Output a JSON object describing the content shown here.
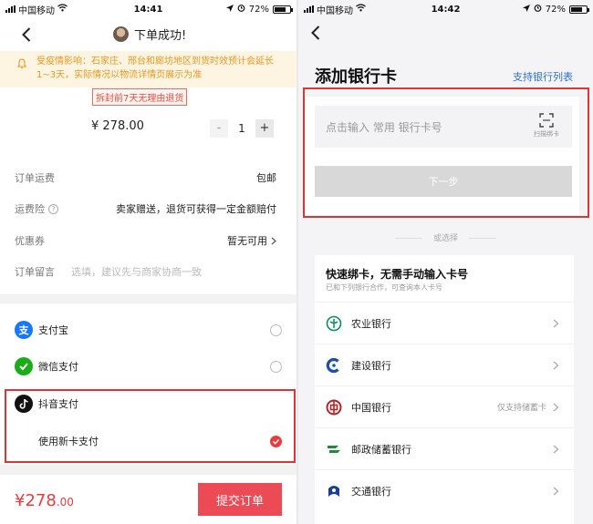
{
  "left": {
    "status": {
      "carrier": "中国移动",
      "time": "14:41",
      "battery": "72%"
    },
    "nav": {
      "title": "下单成功!"
    },
    "notice": "受疫情影响：石家庄、邢台和廊坊地区到货时效预计会延长1~3天，实际情况以物流详情页展示为准",
    "return_tag": "拆封前7天无理由退货",
    "price": "¥ 278.00",
    "stepper": {
      "minus": "-",
      "qty": "1",
      "plus": "+"
    },
    "rows": {
      "shipping": {
        "label": "订单运费",
        "value": "包邮"
      },
      "insurance": {
        "label": "运费险",
        "value": "卖家赠送，退货可获得一定金额赔付"
      },
      "coupon": {
        "label": "优惠券",
        "value": "暂无可用"
      },
      "message": {
        "label": "订单留言",
        "placeholder": "选填，建议先与商家协商一致"
      }
    },
    "payments": {
      "alipay": "支付宝",
      "wechat": "微信支付",
      "douyin": "抖音支付",
      "newcard": "使用新卡支付"
    },
    "total": {
      "main": "¥278",
      "decimal": ".00"
    },
    "submit": "提交订单"
  },
  "right": {
    "status": {
      "carrier": "中国移动",
      "time": "14:42",
      "battery": "72%"
    },
    "title": "添加银行卡",
    "bank_list_link": "支持银行列表",
    "card_input_placeholder": "点击输入 常用 银行卡号",
    "scan_label": "扫描绑卡",
    "next_button": "下一步",
    "or_choose": "或选择",
    "quick": {
      "title": "快速绑卡，无需手动输入卡号",
      "subtitle": "已和下列银行合作，可查询本人卡号"
    },
    "banks": [
      {
        "name": "农业银行",
        "note": "",
        "color": "#0c8c5c"
      },
      {
        "name": "建设银行",
        "note": "",
        "color": "#1f4fa6"
      },
      {
        "name": "中国银行",
        "note": "仅支持储蓄卡",
        "color": "#b0262b"
      },
      {
        "name": "邮政储蓄银行",
        "note": "",
        "color": "#1e8a3a"
      },
      {
        "name": "交通银行",
        "note": "",
        "color": "#1c3f8f"
      }
    ]
  }
}
